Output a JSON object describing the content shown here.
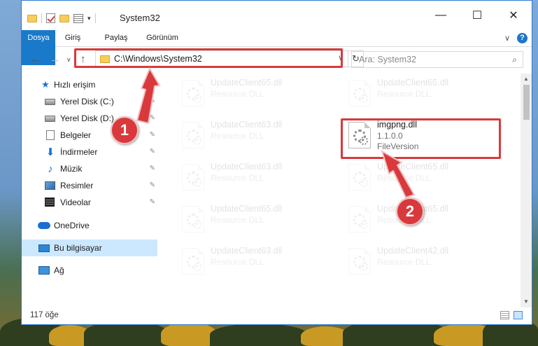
{
  "window": {
    "title": "System32",
    "controls": {
      "minimize": "—",
      "maximize": "☐",
      "close": "✕"
    }
  },
  "ribbon": {
    "tabs": [
      {
        "label": "Dosya"
      },
      {
        "label": "Giriş"
      },
      {
        "label": "Paylaş"
      },
      {
        "label": "Görünüm"
      }
    ]
  },
  "navigation": {
    "address": "C:\\Windows\\System32",
    "search_placeholder": "Ara: System32"
  },
  "sidebar": {
    "items": [
      {
        "label": "Hızlı erişim",
        "icon": "star-icon"
      },
      {
        "label": "Yerel Disk (C:)",
        "icon": "drive-icon",
        "pinned": true
      },
      {
        "label": "Yerel Disk (D:)",
        "icon": "drive-icon",
        "pinned": true
      },
      {
        "label": "Belgeler",
        "icon": "documents-icon",
        "pinned": true
      },
      {
        "label": "İndirmeler",
        "icon": "downloads-icon",
        "pinned": true
      },
      {
        "label": "Müzik",
        "icon": "music-icon",
        "pinned": true
      },
      {
        "label": "Resimler",
        "icon": "pictures-icon",
        "pinned": true
      },
      {
        "label": "Videolar",
        "icon": "videos-icon",
        "pinned": true
      },
      {
        "label": "OneDrive",
        "icon": "onedrive-icon"
      },
      {
        "label": "Bu bilgisayar",
        "icon": "this-pc-icon",
        "selected": true
      },
      {
        "label": "Ağ",
        "icon": "network-icon"
      }
    ]
  },
  "files": [
    {
      "name": "UpdateClient65.dll",
      "type": "Resource DLL"
    },
    {
      "name": "UpdateClient65.dll",
      "type": "Resource DLL"
    },
    {
      "name": "UpdateClient63.dll",
      "type": "Resource DLL"
    },
    {
      "name": "imgpng.dll",
      "version": "1.1.0.0",
      "desc": "FileVersion",
      "highlighted": true
    },
    {
      "name": "UpdateClient63.dll",
      "type": "Resource DLL"
    },
    {
      "name": "UpdateClient65.dll",
      "type": "Resource DLL"
    },
    {
      "name": "UpdateClient65.dll",
      "type": "Resource DLL"
    },
    {
      "name": "UpdateClient65.dll",
      "type": "Resource DLL"
    },
    {
      "name": "UpdateClient63.dll",
      "type": "Resource DLL"
    },
    {
      "name": "UpdateClient42.dll",
      "type": "Resource DLL"
    }
  ],
  "status": {
    "item_count": "117 öğe"
  },
  "annotations": {
    "step1": "1",
    "step2": "2"
  },
  "colors": {
    "accent": "#1979ca",
    "highlight_red": "#d9393c",
    "selected_bg": "#cce8ff"
  }
}
